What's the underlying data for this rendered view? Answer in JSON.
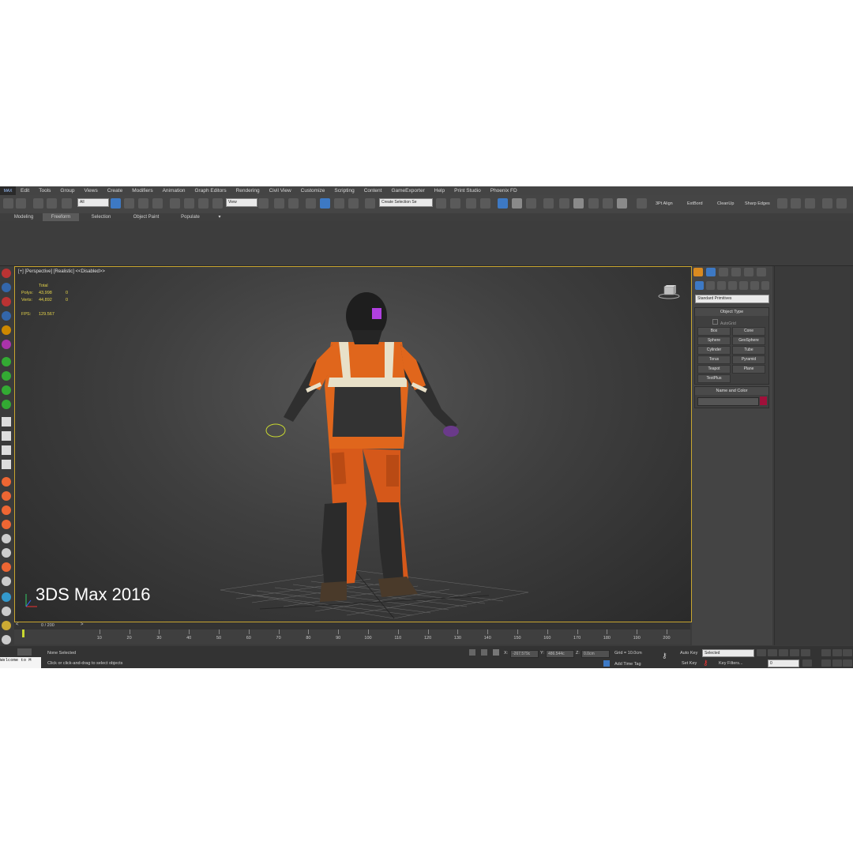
{
  "menubar": {
    "logo": "MAX",
    "items": [
      "Edit",
      "Tools",
      "Group",
      "Views",
      "Create",
      "Modifiers",
      "Animation",
      "Graph Editors",
      "Rendering",
      "Civil View",
      "Customize",
      "Scripting",
      "Content",
      "GameExporter",
      "Help",
      "Print Studio",
      "Phoenix FD"
    ]
  },
  "toolbar": {
    "selection_filter": "All",
    "ref_coord": "View",
    "named_selection": "Create Selection Se",
    "plugins": [
      "3Pt Align",
      "ExtBord",
      "CleanUp",
      "Sharp Edges"
    ]
  },
  "ribbon": {
    "tabs": [
      "Modeling",
      "Freeform",
      "Selection",
      "Object Paint",
      "Populate"
    ],
    "active": "Freeform"
  },
  "viewport": {
    "label": "[+] [Perspective] [Realistic] <<Disabled>>",
    "stats": {
      "header": "Total",
      "rows": [
        {
          "k": "Polys:",
          "v": "43,998",
          "z": "0"
        },
        {
          "k": "Verts:",
          "v": "44,892",
          "z": "0"
        }
      ],
      "fps_label": "FPS:",
      "fps": "129.567"
    },
    "watermark": "3DS Max 2016"
  },
  "command_panel": {
    "category": "Standard Primitives",
    "object_type_title": "Object Type",
    "autogrid": "AutoGrid",
    "primitives": [
      "Box",
      "Cone",
      "Sphere",
      "GeoSphere",
      "Cylinder",
      "Tube",
      "Torus",
      "Pyramid",
      "Teapot",
      "Plane",
      "TextPlus"
    ],
    "name_color_title": "Name and Color",
    "color": "#a0103a"
  },
  "timeline": {
    "slider_label": "0 / 200",
    "ticks": [
      "10",
      "20",
      "30",
      "40",
      "50",
      "60",
      "70",
      "80",
      "90",
      "100",
      "110",
      "120",
      "130",
      "140",
      "150",
      "160",
      "170",
      "180",
      "190",
      "200"
    ]
  },
  "status": {
    "selection": "None Selected",
    "prompt": "Click or click-and-drag to select objects",
    "x_label": "X:",
    "x_value": "-267.579c",
    "y_label": "Y:",
    "y_value": "486.544c",
    "z_label": "Z:",
    "z_value": "0.0cm",
    "grid": "Grid = 10.0cm",
    "add_time_tag": "Add Time Tag",
    "auto_key": "Auto Key",
    "selected": "Selected",
    "set_key": "Set Key",
    "key_filters": "Key Filters...",
    "maxscript": "Welcome to M",
    "frame": "0"
  },
  "colors": {
    "accent_blue": "#3d79c4",
    "viewport_border": "#c9a630",
    "stats_text": "#e6d44a"
  }
}
